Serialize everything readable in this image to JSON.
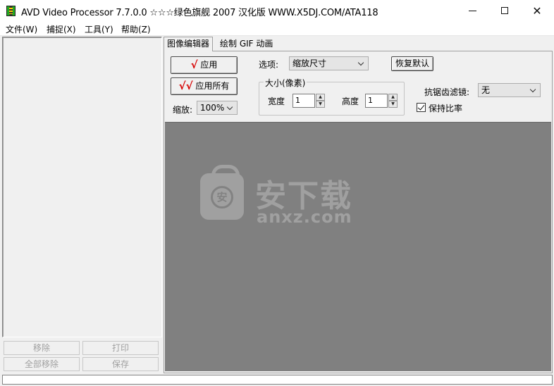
{
  "window": {
    "title": "AVD Video Processor 7.7.0.0        ☆☆☆绿色旗舰 2007 汉化版    WWW.X5DJ.COM/ATA118"
  },
  "menu": {
    "items": [
      "文件(W)",
      "捕捉(X)",
      "工具(Y)",
      "帮助(Z)"
    ]
  },
  "left_panel": {
    "buttons": {
      "remove": "移除",
      "print": "打印",
      "remove_all": "全部移除",
      "save": "保存"
    }
  },
  "tabs": [
    "图像编辑器",
    "绘制 GIF 动画"
  ],
  "editor": {
    "apply": "应用",
    "apply_all": "应用所有",
    "zoom_label": "缩放:",
    "zoom_value": "100%",
    "option_label": "选项:",
    "option_value": "缩放尺寸",
    "restore_default": "恢复默认",
    "size_group": "大小(像素)",
    "width_label": "宽度",
    "width_value": "1",
    "height_label": "高度",
    "height_value": "1",
    "antialias_label": "抗锯齿滤镜:",
    "antialias_value": "无",
    "keep_ratio": "保持比率",
    "check_mark": "√",
    "double_check_mark": "√√"
  },
  "watermark": {
    "cn": "安下载",
    "en": "anxz.com",
    "badge": "安"
  }
}
